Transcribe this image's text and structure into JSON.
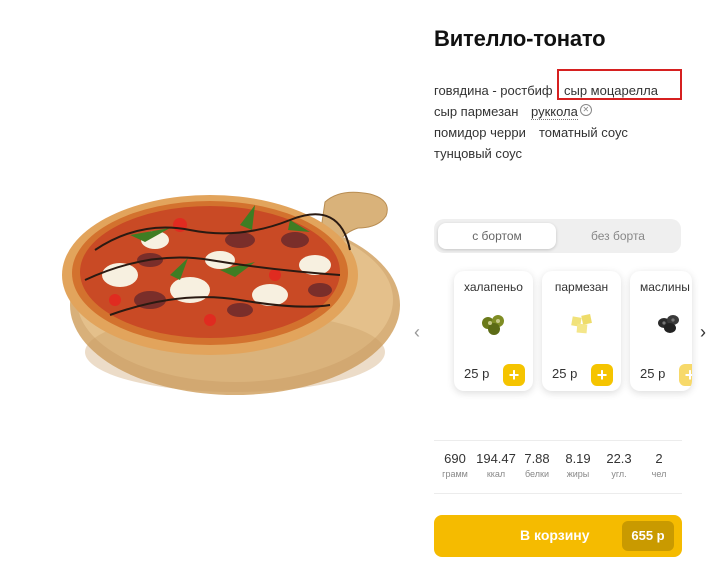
{
  "product": {
    "title": "Вителло-тонато"
  },
  "ingredients": [
    {
      "label": "говядина - ростбиф",
      "removable": false
    },
    {
      "label": "сыр моцарелла",
      "removable": false
    },
    {
      "label": "сыр пармезан",
      "removable": false
    },
    {
      "label": "руккола",
      "removable": true
    },
    {
      "label": "помидор черри",
      "removable": false
    },
    {
      "label": "томатный соус",
      "removable": false
    },
    {
      "label": "тунцовый соус",
      "removable": false
    }
  ],
  "crust": {
    "options": [
      "с бортом",
      "без борта"
    ],
    "selected": "с бортом"
  },
  "toppings": [
    {
      "name": "халапеньо",
      "price": "25 р",
      "icon": "jalapeno-icon",
      "color": "#6b7a1a"
    },
    {
      "name": "пармезан",
      "price": "25 р",
      "icon": "parmesan-icon",
      "color": "#f1e27a"
    },
    {
      "name": "маслины",
      "price": "25 р",
      "icon": "olives-icon",
      "color": "#2b2b2b"
    }
  ],
  "nutrition": [
    {
      "value": "690",
      "label": "грамм"
    },
    {
      "value": "194.47",
      "label": "ккал"
    },
    {
      "value": "7.88",
      "label": "белки"
    },
    {
      "value": "8.19",
      "label": "жиры"
    },
    {
      "value": "22.3",
      "label": "угл."
    },
    {
      "value": "2",
      "label": "чел"
    }
  ],
  "cart": {
    "label": "В корзину",
    "price": "655 р"
  },
  "colors": {
    "accent": "#f5bb00",
    "highlight": "#d62020"
  }
}
